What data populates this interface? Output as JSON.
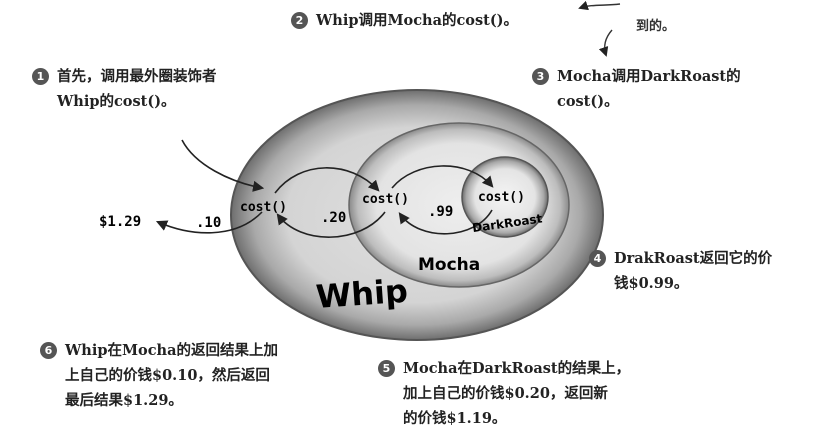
{
  "diagram": {
    "rings": {
      "outer": "Whip",
      "middle": "Mocha",
      "inner": "DarkRoast"
    },
    "calls": [
      "cost()",
      "cost()",
      "cost()"
    ],
    "values": {
      "total": "$1.29",
      "whip": ".10",
      "mocha": ".20",
      "darkroast": ".99"
    },
    "corner_note": [
      "到的。"
    ]
  },
  "steps": [
    {
      "n": "1",
      "lines": [
        "首先，调用最外圈装饰者",
        "Whip的cost()。"
      ]
    },
    {
      "n": "2",
      "lines": [
        "Whip调用Mocha的cost()。"
      ]
    },
    {
      "n": "3",
      "lines": [
        "Mocha调用DarkRoast的",
        "cost()。"
      ]
    },
    {
      "n": "4",
      "lines": [
        "DrakRoast返回它的价",
        "钱$0.99。"
      ]
    },
    {
      "n": "5",
      "lines": [
        "Mocha在DarkRoast的结果上，",
        "加上自己的价钱$0.20，返回新",
        "的价钱$1.19。"
      ]
    },
    {
      "n": "6",
      "lines": [
        "Whip在Mocha的返回结果上加",
        "上自己的价钱$0.10，然后返回",
        "最后结果$1.29。"
      ]
    }
  ]
}
